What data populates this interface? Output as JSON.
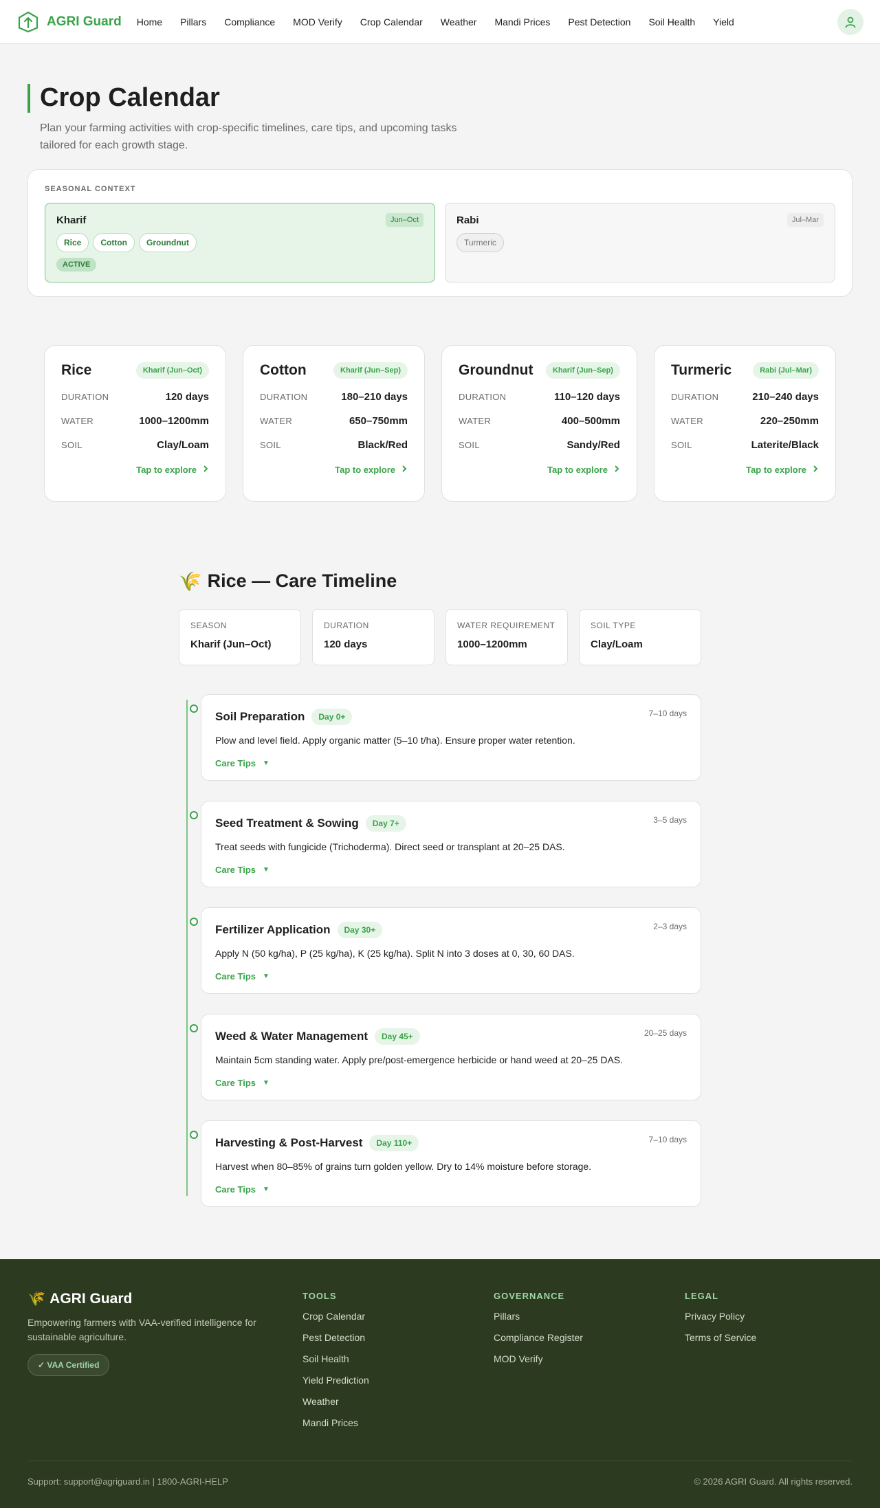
{
  "nav": {
    "brand": "AGRI Guard",
    "links": [
      "Home",
      "Pillars",
      "Compliance",
      "MOD Verify",
      "Crop Calendar",
      "Weather",
      "Mandi Prices",
      "Pest Detection",
      "Soil Health",
      "Yield"
    ]
  },
  "header": {
    "title": "Crop Calendar",
    "subtitle": "Plan your farming activities with crop-specific timelines, care tips, and upcoming tasks tailored for each growth stage."
  },
  "seasonal": {
    "label": "SEASONAL CONTEXT",
    "seasons": [
      {
        "name": "Kharif",
        "months": "Jun–Oct",
        "crops": [
          "Rice",
          "Cotton",
          "Groundnut"
        ],
        "badge": "ACTIVE"
      },
      {
        "name": "Rabi",
        "months": "Jul–Mar",
        "crops": [
          "Turmeric"
        ]
      }
    ]
  },
  "crops": [
    {
      "name": "Rice",
      "season": "Kharif (Jun–Oct)",
      "duration_label": "DURATION",
      "duration": "120 days",
      "water_label": "WATER",
      "water": "1000–1200mm",
      "soil_label": "SOIL",
      "soil": "Clay/Loam",
      "explore": "Tap to explore"
    },
    {
      "name": "Cotton",
      "season": "Kharif (Jun–Sep)",
      "duration_label": "DURATION",
      "duration": "180–210 days",
      "water_label": "WATER",
      "water": "650–750mm",
      "soil_label": "SOIL",
      "soil": "Black/Red",
      "explore": "Tap to explore"
    },
    {
      "name": "Groundnut",
      "season": "Kharif (Jun–Sep)",
      "duration_label": "DURATION",
      "duration": "110–120 days",
      "water_label": "WATER",
      "water": "400–500mm",
      "soil_label": "SOIL",
      "soil": "Sandy/Red",
      "explore": "Tap to explore"
    },
    {
      "name": "Turmeric",
      "season": "Rabi (Jul–Mar)",
      "duration_label": "DURATION",
      "duration": "210–240 days",
      "water_label": "WATER",
      "water": "220–250mm",
      "soil_label": "SOIL",
      "soil": "Laterite/Black",
      "explore": "Tap to explore"
    }
  ],
  "timeline": {
    "icon": "🌾",
    "title": "Rice — Care Timeline",
    "summary": [
      {
        "key": "SEASON",
        "value": "Kharif (Jun–Oct)"
      },
      {
        "key": "DURATION",
        "value": "120 days"
      },
      {
        "key": "WATER REQUIREMENT",
        "value": "1000–1200mm"
      },
      {
        "key": "SOIL TYPE",
        "value": "Clay/Loam"
      }
    ],
    "stages": [
      {
        "name": "Soil Preparation",
        "day": "Day 0+",
        "duration": "7–10 days",
        "desc": "Plow and level field. Apply organic matter (5–10 t/ha). Ensure proper water retention.",
        "tips": "Care Tips"
      },
      {
        "name": "Seed Treatment & Sowing",
        "day": "Day 7+",
        "duration": "3–5 days",
        "desc": "Treat seeds with fungicide (Trichoderma). Direct seed or transplant at 20–25 DAS.",
        "tips": "Care Tips"
      },
      {
        "name": "Fertilizer Application",
        "day": "Day 30+",
        "duration": "2–3 days",
        "desc": "Apply N (50 kg/ha), P (25 kg/ha), K (25 kg/ha). Split N into 3 doses at 0, 30, 60 DAS.",
        "tips": "Care Tips"
      },
      {
        "name": "Weed & Water Management",
        "day": "Day 45+",
        "duration": "20–25 days",
        "desc": "Maintain 5cm standing water. Apply pre/post-emergence herbicide or hand weed at 20–25 DAS.",
        "tips": "Care Tips"
      },
      {
        "name": "Harvesting & Post-Harvest",
        "day": "Day 110+",
        "duration": "7–10 days",
        "desc": "Harvest when 80–85% of grains turn golden yellow. Dry to 14% moisture before storage.",
        "tips": "Care Tips"
      }
    ]
  },
  "footer": {
    "icon": "🌾",
    "brand": "AGRI Guard",
    "desc": "Empowering farmers with VAA-verified intelligence for sustainable agriculture.",
    "badge": "✓ VAA Certified",
    "tools_title": "TOOLS",
    "tools": [
      "Crop Calendar",
      "Pest Detection",
      "Soil Health",
      "Yield Prediction",
      "Weather",
      "Mandi Prices"
    ],
    "gov_title": "GOVERNANCE",
    "gov": [
      "Pillars",
      "Compliance Register",
      "MOD Verify"
    ],
    "legal_title": "LEGAL",
    "legal": [
      "Privacy Policy",
      "Terms of Service"
    ],
    "support": "Support: support@agriguard.in | 1800-AGRI-HELP",
    "copyright": "© 2026 AGRI Guard. All rights reserved."
  },
  "colors": {
    "accent": "#3aa34a",
    "footer_bg": "#2c3a20"
  }
}
